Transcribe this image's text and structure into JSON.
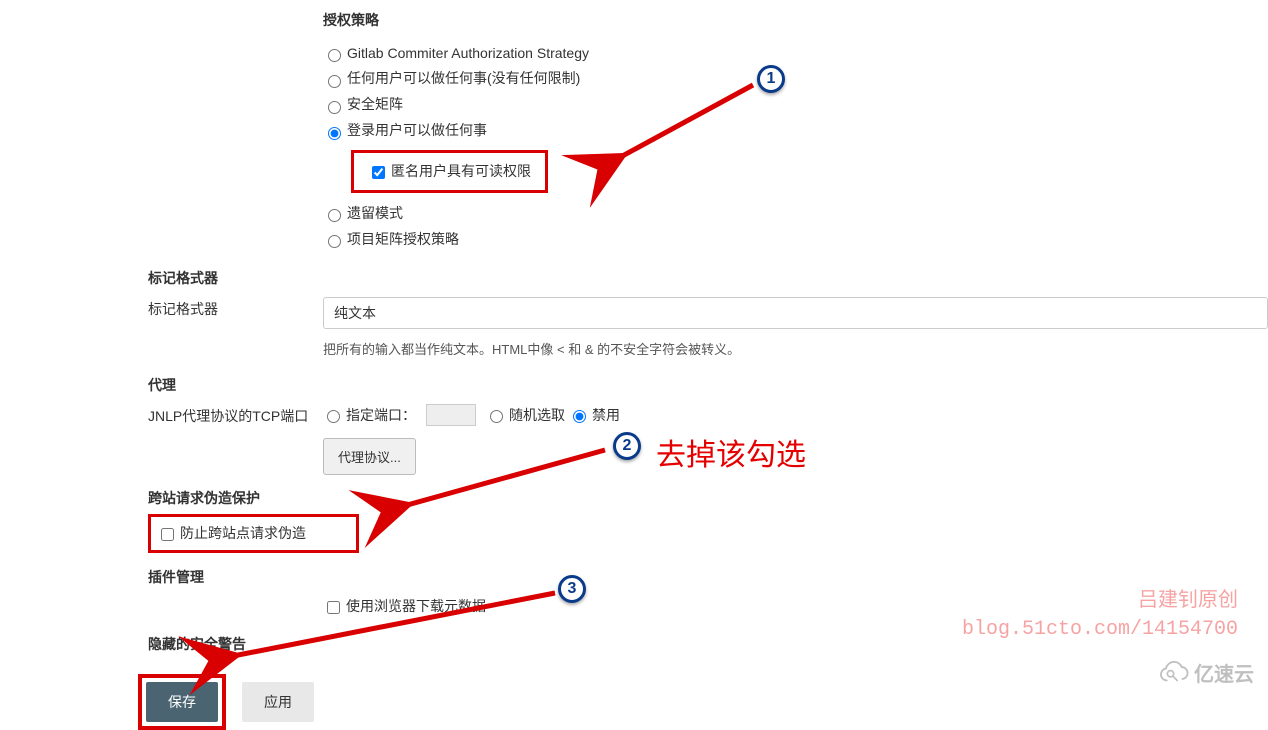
{
  "auth": {
    "title": "授权策略",
    "options": {
      "gitlab": "Gitlab Commiter Authorization Strategy",
      "anyone": "任何用户可以做任何事(没有任何限制)",
      "matrix": "安全矩阵",
      "loggedin": "登录用户可以做任何事",
      "legacy": "遗留模式",
      "projectmatrix": "项目矩阵授权策略"
    },
    "anon_read": "匿名用户具有可读权限"
  },
  "markup": {
    "title": "标记格式器",
    "label": "标记格式器",
    "value": "纯文本",
    "help": "把所有的输入都当作纯文本。HTML中像 < 和 & 的不安全字符会被转义。"
  },
  "agent": {
    "title": "代理",
    "label": "JNLP代理协议的TCP端口",
    "opt_fixed": "指定端口：",
    "opt_random": "随机选取",
    "opt_disabled": "禁用",
    "protocol_btn": "代理协议..."
  },
  "csrf": {
    "title": "跨站请求伪造保护",
    "check": "防止跨站点请求伪造"
  },
  "plugin": {
    "title": "插件管理",
    "check": "使用浏览器下载元数据"
  },
  "hidden_warn": {
    "title": "隐藏的安全警告"
  },
  "buttons": {
    "save": "保存",
    "apply": "应用"
  },
  "annotations": {
    "b1": "1",
    "b2": "2",
    "b3": "3",
    "hint2": "去掉该勾选",
    "wm1": "吕建钊原创",
    "wm2": "blog.51cto.com/14154700",
    "logo": "亿速云"
  }
}
